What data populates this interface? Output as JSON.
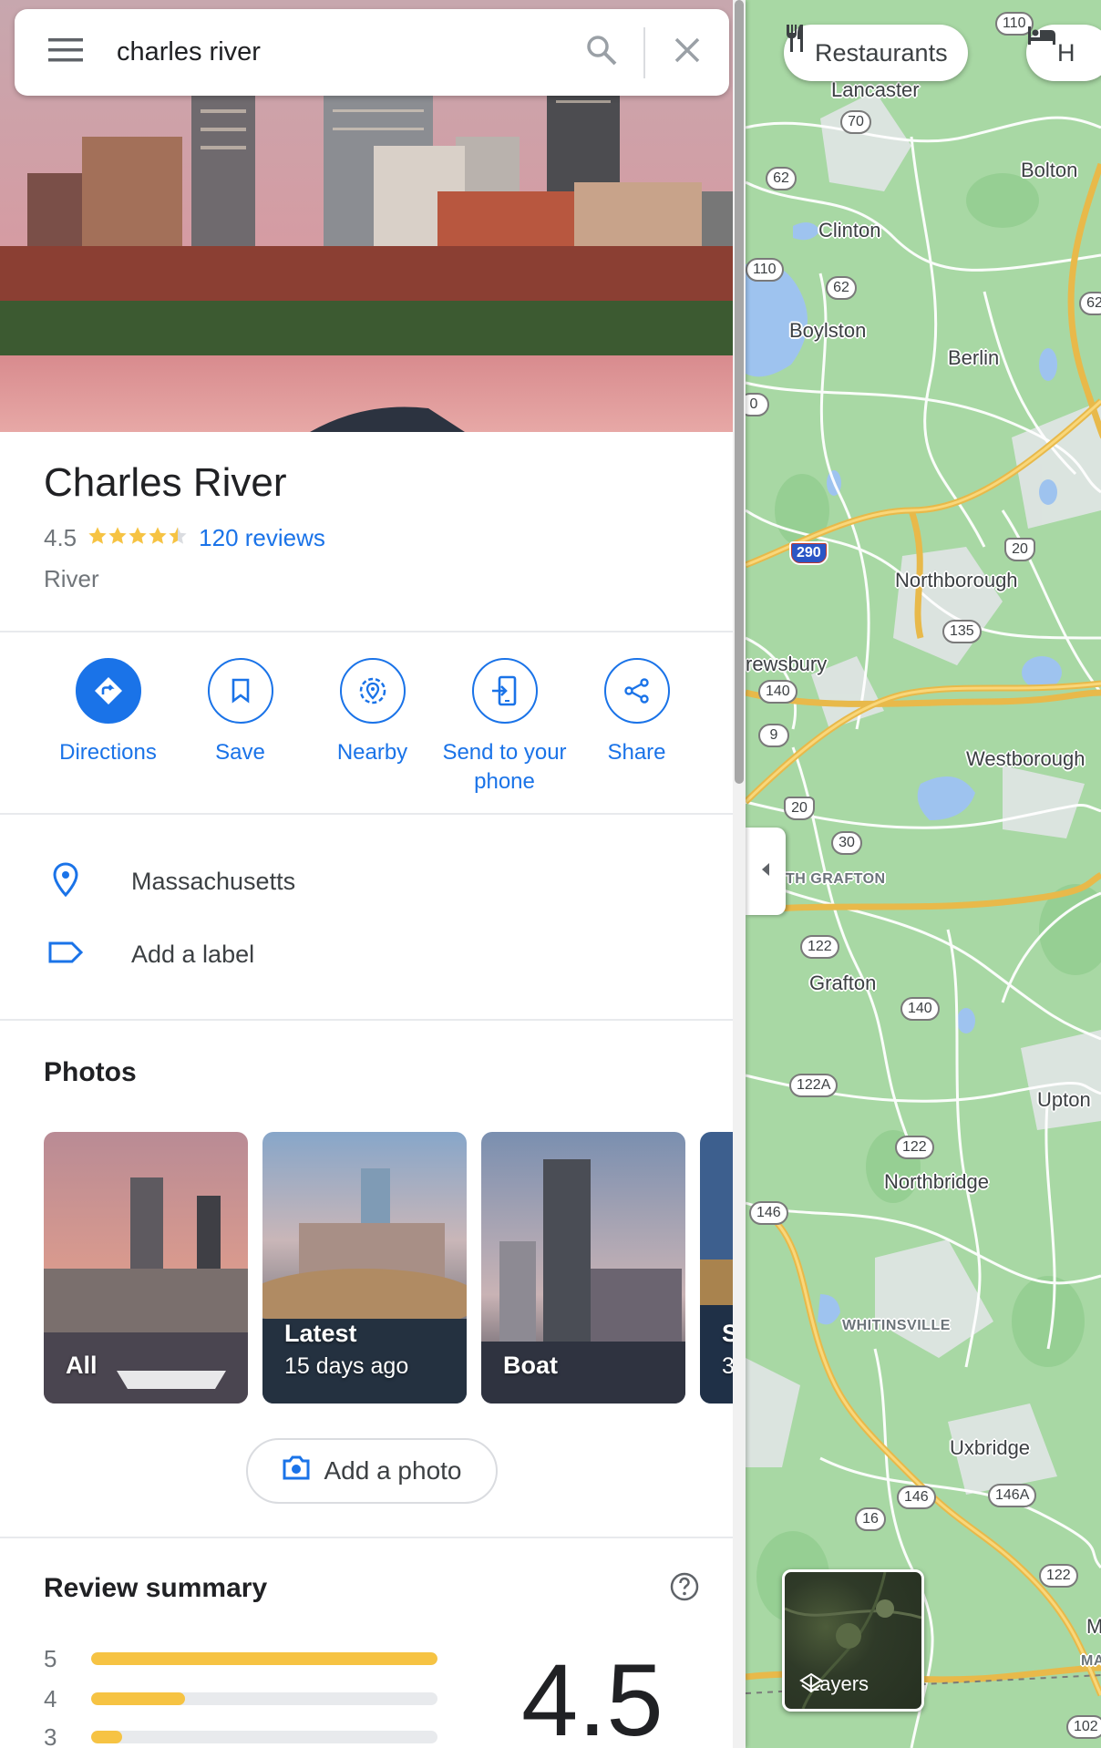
{
  "search": {
    "query": "charles river"
  },
  "place": {
    "title": "Charles River",
    "rating": "4.5",
    "stars_value": 4.5,
    "reviews": "120 reviews",
    "type": "River"
  },
  "actions": [
    {
      "label": "Directions",
      "icon": "directions-icon"
    },
    {
      "label": "Save",
      "icon": "bookmark-icon"
    },
    {
      "label": "Nearby",
      "icon": "nearby-icon"
    },
    {
      "label": "Send to your phone",
      "icon": "send-to-phone-icon"
    },
    {
      "label": "Share",
      "icon": "share-icon"
    }
  ],
  "info": {
    "address": "Massachusetts",
    "add_label": "Add a label"
  },
  "photos": {
    "title": "Photos",
    "items": [
      {
        "label": "All",
        "sub": ""
      },
      {
        "label": "Latest",
        "sub": "15 days ago"
      },
      {
        "label": "Boat",
        "sub": ""
      },
      {
        "label": "S",
        "sub": "3"
      }
    ],
    "add_photo": "Add a photo"
  },
  "review_summary": {
    "title": "Review summary",
    "big_rating": "4.5",
    "rows": [
      {
        "star": "5",
        "fraction": 1.0
      },
      {
        "star": "4",
        "fraction": 0.27
      },
      {
        "star": "3",
        "fraction": 0.09
      }
    ]
  },
  "map": {
    "chips": {
      "restaurants": "Restaurants",
      "hotels": "H"
    },
    "layers": "Layers",
    "places": {
      "lancaster": "Lancaster",
      "bolton": "Bolton",
      "clinton": "Clinton",
      "boylston": "Boylston",
      "berlin": "Berlin",
      "northborough": "Northborough",
      "shrewsbury": "rewsbury",
      "westborough": "Westborough",
      "north_grafton": "TH GRAFTON",
      "grafton": "Grafton",
      "upton": "Upton",
      "northbridge": "Northbridge",
      "whitinsville": "WHITINSVILLE",
      "uxbridge": "Uxbridge",
      "m": "M",
      "ma": "MA"
    },
    "shields": {
      "r110a": "110",
      "r70": "70",
      "r62a": "62",
      "r110b": "110",
      "r62b": "62",
      "r62c": "62",
      "r0": "0",
      "i290": "290",
      "us20a": "20",
      "r135": "135",
      "r140a": "140",
      "r9": "9",
      "us20b": "20",
      "r30": "30",
      "r122a": "122",
      "r140b": "140",
      "r122b": "122A",
      "r122c": "122",
      "r146a": "146",
      "r146b": "146",
      "r146c": "146A",
      "r16": "16",
      "r122d": "122",
      "r102": "102"
    },
    "colors": {
      "land": "#a8d8a4",
      "water": "#9ec3ef",
      "highway": "#f5c95a",
      "road": "#ffffff",
      "urban": "#e8e8ec"
    }
  },
  "colors": {
    "accent": "#1a73e8",
    "star": "#f6c343",
    "text": "#202124",
    "secondary": "#70757a"
  }
}
